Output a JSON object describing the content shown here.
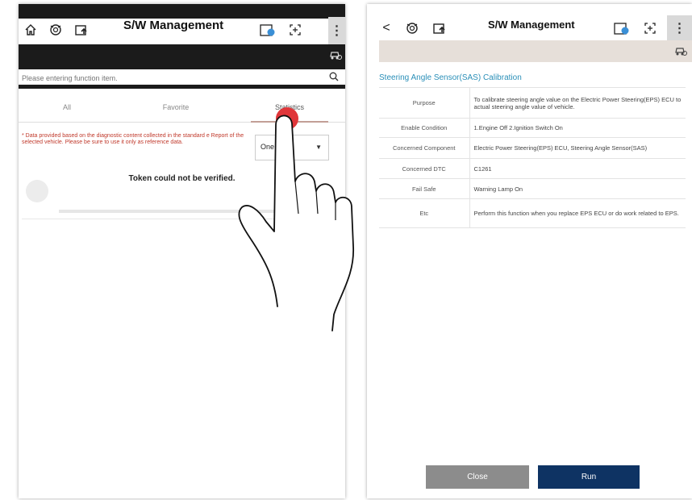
{
  "left_screen": {
    "title": "S/W Management",
    "search": {
      "placeholder": "Please entering function item."
    },
    "tabs": [
      {
        "label": "All"
      },
      {
        "label": "Favorite"
      },
      {
        "label": "Statistics"
      }
    ],
    "notice": "* Data provided based on the diagnostic content collected in the standard e Report of the selected vehicle. Please be sure to use it only as reference data.",
    "period_select": {
      "value": "One y"
    },
    "status_message": "Token could not be verified."
  },
  "right_screen": {
    "title": "S/W Management",
    "back_label": "<",
    "section_title": "Steering Angle Sensor(SAS) Calibration",
    "rows": [
      {
        "label": "Purpose",
        "value": "To calibrate steering angle value on the Electric Power Steering(EPS) ECU to actual steering angle value of vehicle."
      },
      {
        "label": "Enable Condition",
        "value": "1.Engine Off 2.Ignition Switch On"
      },
      {
        "label": "Concerned Component",
        "value": "Electric Power Steering(EPS) ECU, Steering Angle Sensor(SAS)"
      },
      {
        "label": "Concerned DTC",
        "value": "C1261"
      },
      {
        "label": "Fail Safe",
        "value": "Warning Lamp On"
      },
      {
        "label": "Etc",
        "value": "Perform this function when you replace EPS ECU or do work related to EPS."
      }
    ],
    "buttons": {
      "close": "Close",
      "run": "Run"
    }
  },
  "icons": [
    "home-icon",
    "diagnostic-icon",
    "upload-icon",
    "calendar-icon",
    "expand-icon",
    "kebab-menu-icon",
    "car-icon",
    "search-icon",
    "chevron-down-icon",
    "back-icon"
  ],
  "colors": {
    "header_dark": "#1b1b1b",
    "notice_red": "#c0392b",
    "section_blue": "#2a8fb8",
    "run_button": "#0e3363",
    "close_button": "#8c8c8c",
    "tap_marker": "#e0363a"
  }
}
